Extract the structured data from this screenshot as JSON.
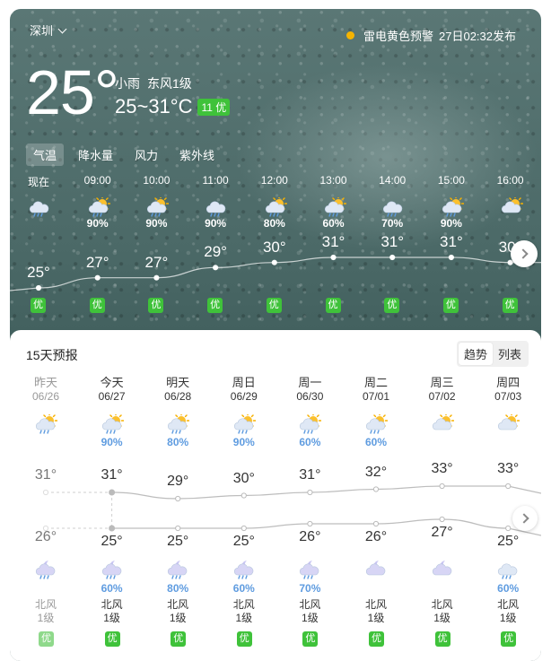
{
  "colors": {
    "aqi_good": "#3fc23a",
    "alert_yellow": "#f5b400",
    "precip_blue": "#5f9ce0"
  },
  "location": {
    "city": "深圳"
  },
  "alert": {
    "text": "雷电黄色预警",
    "issued": "27日02:32发布"
  },
  "current": {
    "temp": "25°",
    "condition": "小雨",
    "wind": "东风1级",
    "range": "25~31°C",
    "aqi_badge": "11 优"
  },
  "hourly_tabs": [
    {
      "label": "气温",
      "active": true
    },
    {
      "label": "降水量",
      "active": false
    },
    {
      "label": "风力",
      "active": false
    },
    {
      "label": "紫外线",
      "active": false
    }
  ],
  "hourly": [
    {
      "time": "现在",
      "icon": "cloud-rain-icon",
      "pop": "",
      "temp": "25°",
      "temp_value": 25,
      "aqi": "优"
    },
    {
      "time": "09:00",
      "icon": "sun-cloud-rain-icon",
      "pop": "90%",
      "temp": "27°",
      "temp_value": 27,
      "aqi": "优"
    },
    {
      "time": "10:00",
      "icon": "sun-cloud-rain-icon",
      "pop": "90%",
      "temp": "27°",
      "temp_value": 27,
      "aqi": "优"
    },
    {
      "time": "11:00",
      "icon": "cloud-rain-icon",
      "pop": "90%",
      "temp": "29°",
      "temp_value": 29,
      "aqi": "优"
    },
    {
      "time": "12:00",
      "icon": "sun-cloud-rain-icon",
      "pop": "80%",
      "temp": "30°",
      "temp_value": 30,
      "aqi": "优"
    },
    {
      "time": "13:00",
      "icon": "sun-cloud-rain-icon",
      "pop": "60%",
      "temp": "31°",
      "temp_value": 31,
      "aqi": "优"
    },
    {
      "time": "14:00",
      "icon": "cloud-rain-icon",
      "pop": "70%",
      "temp": "31°",
      "temp_value": 31,
      "aqi": "优"
    },
    {
      "time": "15:00",
      "icon": "sun-cloud-rain-icon",
      "pop": "90%",
      "temp": "31°",
      "temp_value": 31,
      "aqi": "优"
    },
    {
      "time": "16:00",
      "icon": "sun-cloud-icon",
      "pop": "",
      "temp": "30°",
      "temp_value": 30,
      "aqi": "优"
    }
  ],
  "forecast": {
    "title": "15天预报",
    "views": [
      {
        "label": "趋势",
        "active": true
      },
      {
        "label": "列表",
        "active": false
      }
    ],
    "days": [
      {
        "name": "昨天",
        "date": "06/26",
        "past": true,
        "day_icon": "sun-cloud-rain-icon",
        "day_pop": "",
        "high": "31°",
        "high_value": 31,
        "low": "26°",
        "low_value": 26,
        "night_icon": "moon-cloud-rain-icon",
        "night_pop": "",
        "wind_dir": "北风",
        "wind_lvl": "1级",
        "aqi": "优"
      },
      {
        "name": "今天",
        "date": "06/27",
        "past": false,
        "day_icon": "sun-cloud-rain-icon",
        "day_pop": "90%",
        "high": "31°",
        "high_value": 31,
        "low": "25°",
        "low_value": 25,
        "night_icon": "moon-cloud-rain-icon",
        "night_pop": "60%",
        "wind_dir": "北风",
        "wind_lvl": "1级",
        "aqi": "优"
      },
      {
        "name": "明天",
        "date": "06/28",
        "past": false,
        "day_icon": "sun-cloud-rain-icon",
        "day_pop": "80%",
        "high": "29°",
        "high_value": 29,
        "low": "25°",
        "low_value": 25,
        "night_icon": "moon-cloud-rain-icon",
        "night_pop": "80%",
        "wind_dir": "北风",
        "wind_lvl": "1级",
        "aqi": "优"
      },
      {
        "name": "周日",
        "date": "06/29",
        "past": false,
        "day_icon": "sun-cloud-rain-icon",
        "day_pop": "90%",
        "high": "30°",
        "high_value": 30,
        "low": "25°",
        "low_value": 25,
        "night_icon": "moon-cloud-rain-icon",
        "night_pop": "60%",
        "wind_dir": "北风",
        "wind_lvl": "1级",
        "aqi": "优"
      },
      {
        "name": "周一",
        "date": "06/30",
        "past": false,
        "day_icon": "sun-cloud-rain-icon",
        "day_pop": "60%",
        "high": "31°",
        "high_value": 31,
        "low": "26°",
        "low_value": 26,
        "night_icon": "moon-cloud-rain-icon",
        "night_pop": "70%",
        "wind_dir": "北风",
        "wind_lvl": "1级",
        "aqi": "优"
      },
      {
        "name": "周二",
        "date": "07/01",
        "past": false,
        "day_icon": "sun-cloud-rain-icon",
        "day_pop": "60%",
        "high": "32°",
        "high_value": 32,
        "low": "26°",
        "low_value": 26,
        "night_icon": "moon-cloud-icon",
        "night_pop": "",
        "wind_dir": "北风",
        "wind_lvl": "1级",
        "aqi": "优"
      },
      {
        "name": "周三",
        "date": "07/02",
        "past": false,
        "day_icon": "sun-cloud-icon",
        "day_pop": "",
        "high": "33°",
        "high_value": 33,
        "low": "27°",
        "low_value": 27,
        "night_icon": "moon-cloud-icon",
        "night_pop": "",
        "wind_dir": "北风",
        "wind_lvl": "1级",
        "aqi": "优"
      },
      {
        "name": "周四",
        "date": "07/03",
        "past": false,
        "day_icon": "sun-cloud-icon",
        "day_pop": "",
        "high": "33°",
        "high_value": 33,
        "low": "25°",
        "low_value": 25,
        "night_icon": "cloud-rain-icon",
        "night_pop": "60%",
        "wind_dir": "北风",
        "wind_lvl": "1级",
        "aqi": "优"
      }
    ]
  }
}
